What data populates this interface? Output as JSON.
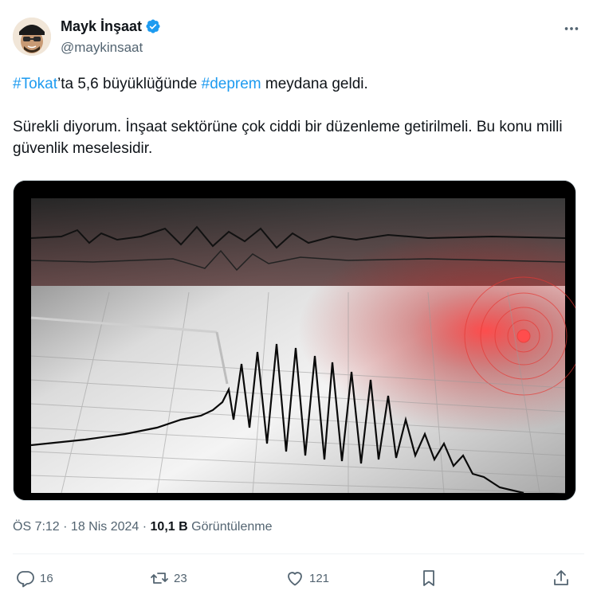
{
  "author": {
    "display_name": "Mayk İnşaat",
    "handle": "@maykinsaat",
    "verified_icon": "verified-badge-icon"
  },
  "tweet": {
    "line1": {
      "hashtag1": "#Tokat",
      "text1": "’ta 5,6 büyüklüğünde ",
      "hashtag2": "#deprem",
      "text2": " meydana geldi."
    },
    "paragraph2": "Sürekli diyorum. İnşaat sektörüne çok ciddi bir düzenleme getirilmeli. Bu konu milli güvenlik meselesidir."
  },
  "meta": {
    "time": "ÖS 7:12",
    "separator": " · ",
    "date": "18 Nis 2024",
    "views_count": "10,1 B",
    "views_label": " Görüntülenme"
  },
  "actions": {
    "replies": "16",
    "reposts": "23",
    "likes": "121"
  },
  "colors": {
    "accent": "#1d9bf0",
    "secondary_text": "#536471",
    "primary_text": "#0f1419"
  }
}
